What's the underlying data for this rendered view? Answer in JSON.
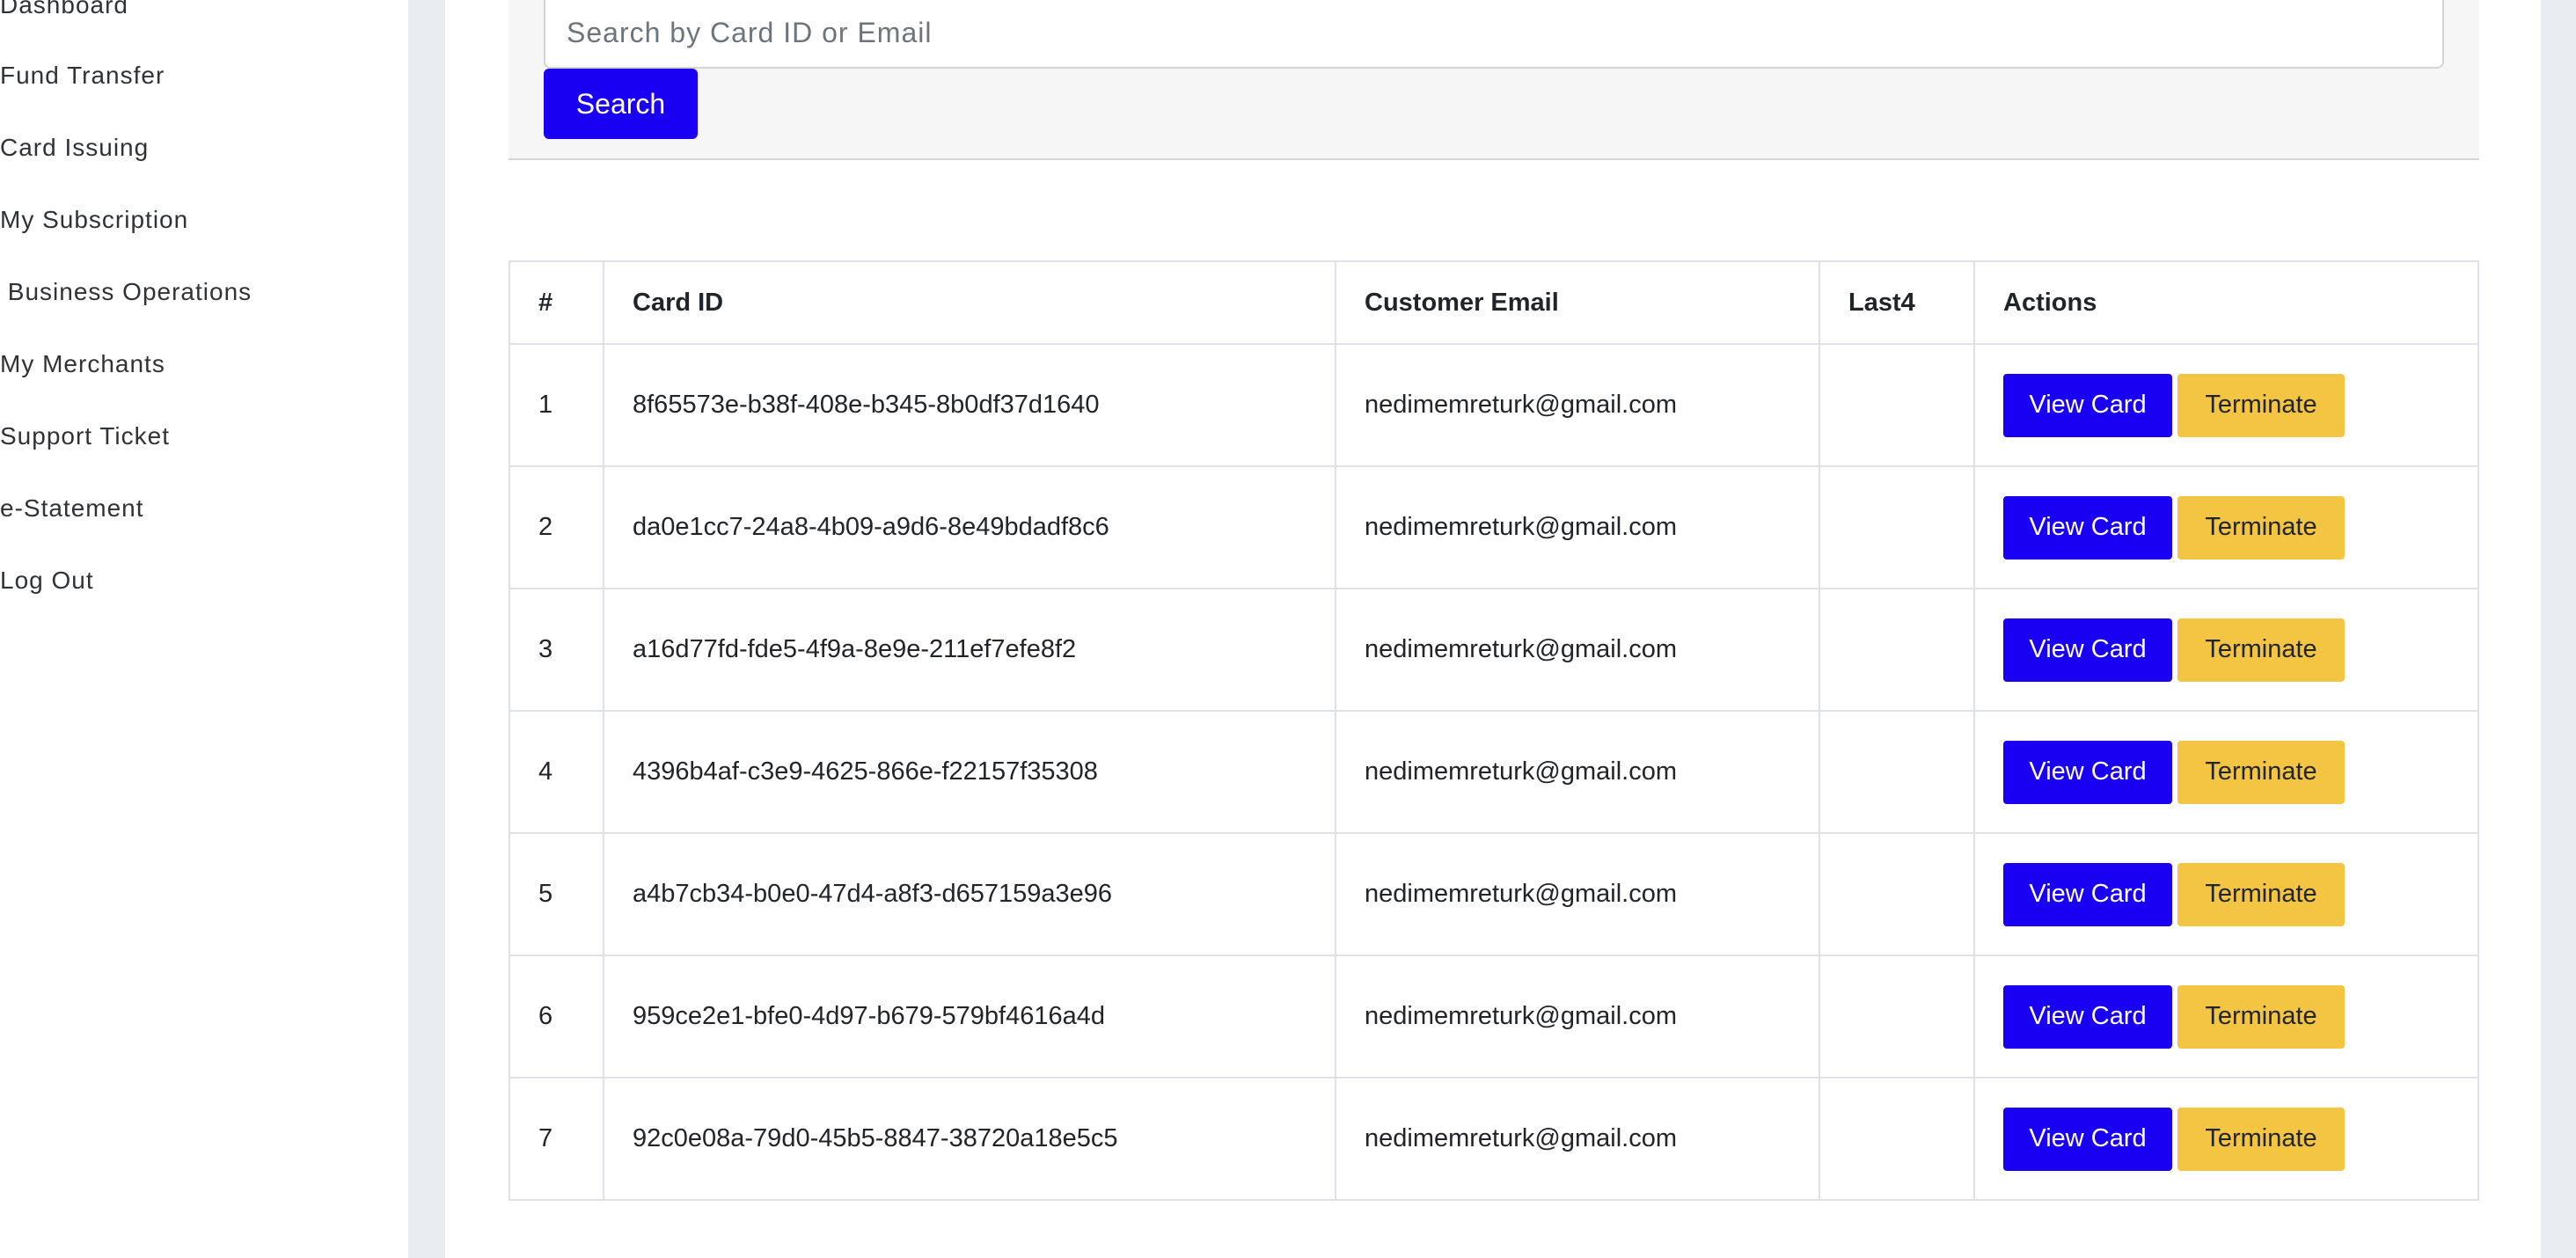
{
  "sidebar": {
    "items": [
      {
        "label": "Dashboard"
      },
      {
        "label": "Fund Transfer"
      },
      {
        "label": "Card Issuing"
      },
      {
        "label": "My Subscription"
      },
      {
        "label": " Business Operations"
      },
      {
        "label": "My Merchants"
      },
      {
        "label": "Support Ticket"
      },
      {
        "label": "e-Statement"
      },
      {
        "label": "Log Out"
      }
    ]
  },
  "search": {
    "placeholder": "Search by Card ID or Email",
    "value": "",
    "button_label": "Search"
  },
  "table": {
    "headers": [
      "#",
      "Card ID",
      "Customer Email",
      "Last4",
      "Actions"
    ],
    "view_label": "View Card",
    "terminate_label": "Terminate",
    "rows": [
      {
        "num": "1",
        "card_id": "8f65573e-b38f-408e-b345-8b0df37d1640",
        "email": "nedimemreturk@gmail.com",
        "last4": ""
      },
      {
        "num": "2",
        "card_id": "da0e1cc7-24a8-4b09-a9d6-8e49bdadf8c6",
        "email": "nedimemreturk@gmail.com",
        "last4": ""
      },
      {
        "num": "3",
        "card_id": "a16d77fd-fde5-4f9a-8e9e-211ef7efe8f2",
        "email": "nedimemreturk@gmail.com",
        "last4": ""
      },
      {
        "num": "4",
        "card_id": "4396b4af-c3e9-4625-866e-f22157f35308",
        "email": "nedimemreturk@gmail.com",
        "last4": ""
      },
      {
        "num": "5",
        "card_id": "a4b7cb34-b0e0-47d4-a8f3-d657159a3e96",
        "email": "nedimemreturk@gmail.com",
        "last4": ""
      },
      {
        "num": "6",
        "card_id": "959ce2e1-bfe0-4d97-b679-579bf4616a4d",
        "email": "nedimemreturk@gmail.com",
        "last4": ""
      },
      {
        "num": "7",
        "card_id": "92c0e08a-79d0-45b5-8847-38720a18e5c5",
        "email": "nedimemreturk@gmail.com",
        "last4": ""
      }
    ]
  },
  "colors": {
    "primary": "#1a00f2",
    "warning": "#f4c542",
    "page_bg": "#e9ecf1"
  }
}
